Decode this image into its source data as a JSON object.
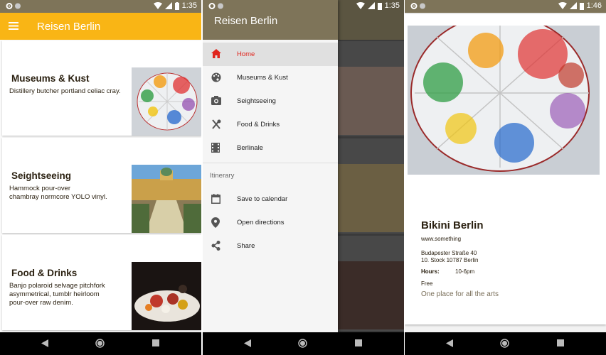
{
  "status": {
    "time_1": "1:35",
    "time_2": "1:35",
    "time_3": "1:46"
  },
  "list_screen": {
    "title": "Reisen Berlin",
    "cards": [
      {
        "title": "Museums & Kust",
        "description": "Distillery butcher portland celiac cray."
      },
      {
        "title": "Seightseeing",
        "description_lines": [
          "Hammock pour-over",
          "chambray normcore YOLO vinyl."
        ]
      },
      {
        "title": "Food & Drinks",
        "description_lines": [
          "Banjo polaroid selvage pitchfork",
          "asymmetrical, tumblr heirloom",
          "pour-over raw denim."
        ]
      }
    ]
  },
  "drawer_screen": {
    "title": "Reisen Berlin",
    "items": [
      {
        "label": "Home",
        "icon": "home-icon",
        "active": true
      },
      {
        "label": "Museums & Kust",
        "icon": "palette-icon"
      },
      {
        "label": "Seightseeing",
        "icon": "camera-icon"
      },
      {
        "label": "Food & Drinks",
        "icon": "restaurant-icon"
      },
      {
        "label": "Berlinale",
        "icon": "film-icon"
      }
    ],
    "section_title": "Itinerary",
    "section_items": [
      {
        "label": "Save to calendar",
        "icon": "calendar-icon"
      },
      {
        "label": "Open directions",
        "icon": "location-pin-icon"
      },
      {
        "label": "Share",
        "icon": "share-icon"
      }
    ]
  },
  "detail_screen": {
    "title": "Bikini Berlin",
    "website": "www.something",
    "address_line1": "Budapester Straße 40",
    "address_line2": "10. Stock 10787 Berlin",
    "hours_label": "Hours:",
    "hours_value": "10-6pm",
    "price": "Free",
    "tagline": "One place for all the arts"
  },
  "colors": {
    "primary": "#f9b515",
    "primary_dark": "#7e7459",
    "active_text": "#e0241c"
  }
}
